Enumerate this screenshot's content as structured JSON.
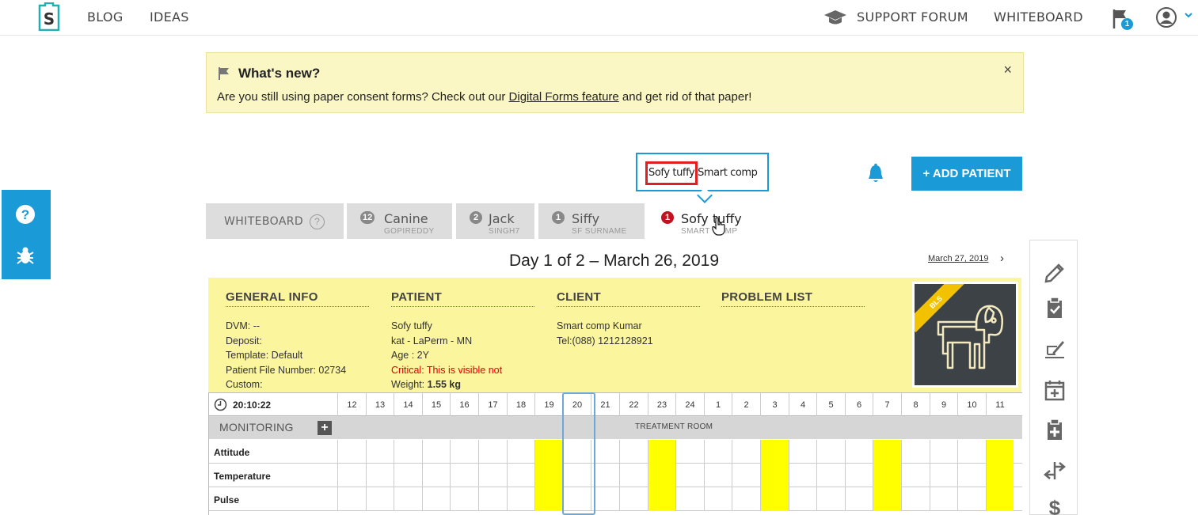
{
  "nav": {
    "blog": "BLOG",
    "ideas": "IDEAS",
    "support_forum": "SUPPORT FORUM",
    "whiteboard": "WHITEBOARD",
    "flag_count": "1"
  },
  "whats_new": {
    "title": "What's new?",
    "text_before": "Are you still using paper consent forms? Check out our ",
    "link": "Digital Forms feature",
    "text_after": " and get rid of that paper!",
    "close": "×"
  },
  "tooltip": {
    "text": "Sofy tuffy Smart comp"
  },
  "add_patient": "+ ADD PATIENT",
  "tabs": [
    {
      "name": "WHITEBOARD",
      "help": "?"
    },
    {
      "badge": "12",
      "name": "Canine",
      "sub": "GOPIREDDY"
    },
    {
      "badge": "2",
      "name": "Jack",
      "sub": "SINGH7"
    },
    {
      "badge": "1",
      "name": "Siffy",
      "sub": "SF SURNAME"
    },
    {
      "badge": "1",
      "name": "Sofy tuffy",
      "sub": "SMART COMP"
    }
  ],
  "day": {
    "title": "Day 1 of 2 – March 26, 2019",
    "next": "March 27, 2019",
    "next_arrow": "›"
  },
  "general_info": {
    "heading": "GENERAL INFO",
    "lines": [
      "DVM: --",
      "Deposit:",
      "Template: Default",
      "Patient File Number: 02734",
      "Custom:"
    ]
  },
  "patient": {
    "heading": "PATIENT",
    "name": "Sofy tuffy",
    "breed": "kat - LaPerm - MN",
    "age": "Age : 2Y",
    "critical": "Critical: This is visible not",
    "weight_label": "Weight: ",
    "weight_value": "1.55 kg"
  },
  "client": {
    "heading": "CLIENT",
    "name": "Smart comp Kumar",
    "tel": "Tel:(088) 1212128921"
  },
  "problem_list": {
    "heading": "PROBLEM LIST"
  },
  "bls": "BLS",
  "grid": {
    "clock": "20:10:22",
    "hours": [
      "12",
      "13",
      "14",
      "15",
      "16",
      "17",
      "18",
      "19",
      "20",
      "21",
      "22",
      "23",
      "24",
      "1",
      "2",
      "3",
      "4",
      "5",
      "6",
      "7",
      "8",
      "9",
      "10",
      "11"
    ],
    "monitoring": "MONITORING",
    "add": "+",
    "room": "TREATMENT ROOM",
    "rows": [
      "Attitude",
      "Temperature",
      "Pulse"
    ],
    "highlight_hours": [
      "19",
      "23",
      "3",
      "7",
      "11"
    ]
  },
  "colors": {
    "accent": "#1a9ad6",
    "highlight": "#ffff00",
    "info_bg": "#fbf59e",
    "critical": "#e00000"
  }
}
